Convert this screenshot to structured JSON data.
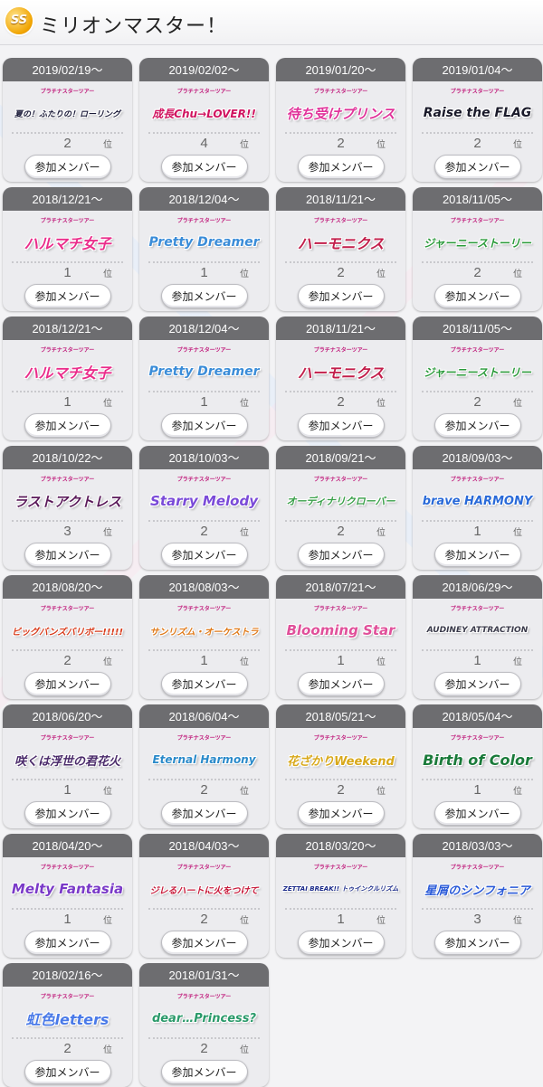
{
  "header": {
    "badge": "SS",
    "title": "ミリオンマスター！"
  },
  "card_sublabel": "プラチナスターツアー",
  "button_label": "参加メンバー",
  "rank_unit": "位",
  "cards": [
    {
      "date": "2019/02/19～",
      "event": "夏の！ふたりの！ローリング",
      "rank": "2",
      "color": "#1c1c3a"
    },
    {
      "date": "2019/02/02～",
      "event": "成長Chu→LOVER!!",
      "rank": "4",
      "color": "#d0135f"
    },
    {
      "date": "2019/01/20～",
      "event": "待ち受けプリンス",
      "rank": "2",
      "color": "#e0339a"
    },
    {
      "date": "2019/01/04～",
      "event": "Raise the FLAG",
      "rank": "2",
      "color": "#1a1a2a"
    },
    {
      "date": "2018/12/21～",
      "event": "ハルマチ女子",
      "rank": "1",
      "color": "#ea2c8a"
    },
    {
      "date": "2018/12/04～",
      "event": "Pretty Dreamer",
      "rank": "1",
      "color": "#3a8cd8"
    },
    {
      "date": "2018/11/21～",
      "event": "ハーモニクス",
      "rank": "2",
      "color": "#c21e4a"
    },
    {
      "date": "2018/11/05～",
      "event": "ジャーニーストーリー",
      "rank": "2",
      "color": "#2a9a3a"
    },
    {
      "date": "2018/12/21～",
      "event": "ハルマチ女子",
      "rank": "1",
      "color": "#ea2c8a"
    },
    {
      "date": "2018/12/04～",
      "event": "Pretty Dreamer",
      "rank": "1",
      "color": "#3a8cd8"
    },
    {
      "date": "2018/11/21～",
      "event": "ハーモニクス",
      "rank": "2",
      "color": "#c21e4a"
    },
    {
      "date": "2018/11/05～",
      "event": "ジャーニーストーリー",
      "rank": "2",
      "color": "#2a9a3a"
    },
    {
      "date": "2018/10/22～",
      "event": "ラストアクトレス",
      "rank": "3",
      "color": "#5a1a5a"
    },
    {
      "date": "2018/10/03～",
      "event": "Starry Melody",
      "rank": "2",
      "color": "#7a4ad8"
    },
    {
      "date": "2018/09/21～",
      "event": "オーディナリクローバー",
      "rank": "2",
      "color": "#3aa04a"
    },
    {
      "date": "2018/09/03～",
      "event": "brave HARMONY",
      "rank": "1",
      "color": "#2a6ad8"
    },
    {
      "date": "2018/08/20～",
      "event": "ビッグバンズバリボー!!!!!",
      "rank": "2",
      "color": "#d83a1a"
    },
    {
      "date": "2018/08/03～",
      "event": "サンリズム・オーケストラ",
      "rank": "1",
      "color": "#e07a1a"
    },
    {
      "date": "2018/07/21～",
      "event": "Blooming Star",
      "rank": "1",
      "color": "#e0509a"
    },
    {
      "date": "2018/06/29～",
      "event": "AUDINEY ATTRACTION",
      "rank": "1",
      "color": "#3a3a4a"
    },
    {
      "date": "2018/06/20～",
      "event": "咲くは浮世の君花火",
      "rank": "1",
      "color": "#4a2a6a"
    },
    {
      "date": "2018/06/04～",
      "event": "Eternal Harmony",
      "rank": "2",
      "color": "#2a8aca"
    },
    {
      "date": "2018/05/21～",
      "event": "花ざかりWeekend",
      "rank": "2",
      "color": "#d8a81a"
    },
    {
      "date": "2018/05/04～",
      "event": "Birth of Color",
      "rank": "1",
      "color": "#1a7a3a"
    },
    {
      "date": "2018/04/20～",
      "event": "Melty Fantasia",
      "rank": "1",
      "color": "#7a3ac8"
    },
    {
      "date": "2018/04/03～",
      "event": "ジレるハートに火をつけて",
      "rank": "2",
      "color": "#c81a3a"
    },
    {
      "date": "2018/03/20～",
      "event": "ZETTAI BREAK!! トゥインクルリズム",
      "rank": "1",
      "color": "#1a2a8a"
    },
    {
      "date": "2018/03/03～",
      "event": "星屑のシンフォニア",
      "rank": "3",
      "color": "#2a5ad8"
    },
    {
      "date": "2018/02/16～",
      "event": "虹色letters",
      "rank": "2",
      "color": "#4a7ae8"
    },
    {
      "date": "2018/01/31～",
      "event": "dear…Princess?",
      "rank": "2",
      "color": "#2a9a6a"
    }
  ]
}
